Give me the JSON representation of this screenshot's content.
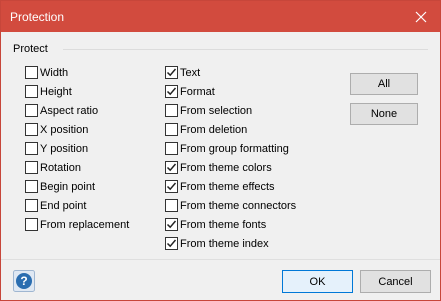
{
  "window": {
    "title": "Protection"
  },
  "group": {
    "label": "Protect"
  },
  "left_column": [
    {
      "label": "Width",
      "checked": false
    },
    {
      "label": "Height",
      "checked": false
    },
    {
      "label": "Aspect ratio",
      "checked": false
    },
    {
      "label": "X position",
      "checked": false
    },
    {
      "label": "Y position",
      "checked": false
    },
    {
      "label": "Rotation",
      "checked": false
    },
    {
      "label": "Begin point",
      "checked": false
    },
    {
      "label": "End point",
      "checked": false
    },
    {
      "label": "From replacement",
      "checked": false
    }
  ],
  "right_column": [
    {
      "label": "Text",
      "checked": true
    },
    {
      "label": "Format",
      "checked": true
    },
    {
      "label": "From selection",
      "checked": false
    },
    {
      "label": "From deletion",
      "checked": false
    },
    {
      "label": "From group formatting",
      "checked": false
    },
    {
      "label": "From theme colors",
      "checked": true
    },
    {
      "label": "From theme effects",
      "checked": true
    },
    {
      "label": "From theme connectors",
      "checked": false
    },
    {
      "label": "From theme fonts",
      "checked": true
    },
    {
      "label": "From theme index",
      "checked": true
    }
  ],
  "buttons": {
    "all": "All",
    "none": "None",
    "ok": "OK",
    "cancel": "Cancel"
  },
  "icons": {
    "close": "close-icon",
    "help": "help-icon"
  },
  "colors": {
    "titlebar": "#d24b3e",
    "help_icon": "#2a6db0",
    "ok_border": "#0078d7"
  }
}
